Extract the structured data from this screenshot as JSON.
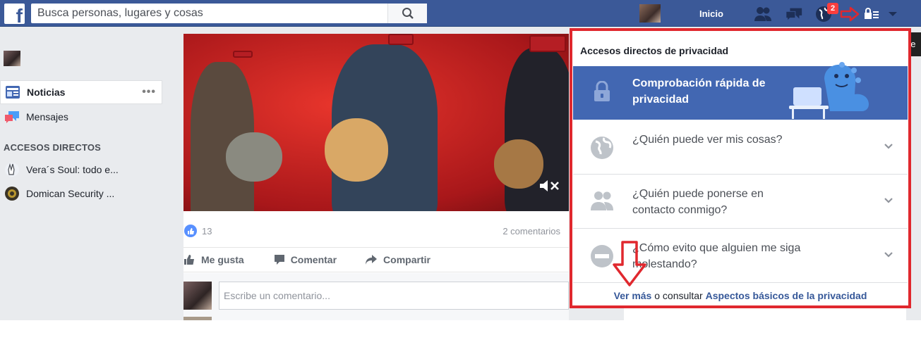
{
  "topbar": {
    "logo_letter": "f",
    "search_placeholder": "Busca personas, lugares y cosas",
    "home_label": "Inicio",
    "notifications_count": "2",
    "tooltip": "Accesos dire"
  },
  "sidebar": {
    "heading": "ACCESOS DIRECTOS",
    "items": [
      {
        "label": "Noticias",
        "more": "•••"
      },
      {
        "label": "Mensajes"
      }
    ],
    "shortcuts": [
      {
        "label": "Vera´s Soul: todo e..."
      },
      {
        "label": "Domican Security ..."
      }
    ]
  },
  "post": {
    "like_count": "13",
    "comment_count": "2 comentarios",
    "actions": {
      "like": "Me gusta",
      "comment": "Comentar",
      "share": "Compartir"
    },
    "comment_placeholder": "Escribe un comentario..."
  },
  "privacy_menu": {
    "title": "Accesos directos de privacidad",
    "quick_check": "Comprobación rápida de privacidad",
    "questions": [
      "¿Quién puede ver mis cosas?",
      "¿Quién puede ponerse en contacto conmigo?",
      "¿Cómo evito que alguien me siga molestando?"
    ],
    "footer_more": "Ver más",
    "footer_middle": " o consultar ",
    "footer_basics": "Aspectos básicos de la privacidad"
  },
  "colors": {
    "topbar": "#3b5998",
    "quick_check_bg": "#4267b2",
    "annotation_red": "#e0282e",
    "link": "#365899"
  }
}
